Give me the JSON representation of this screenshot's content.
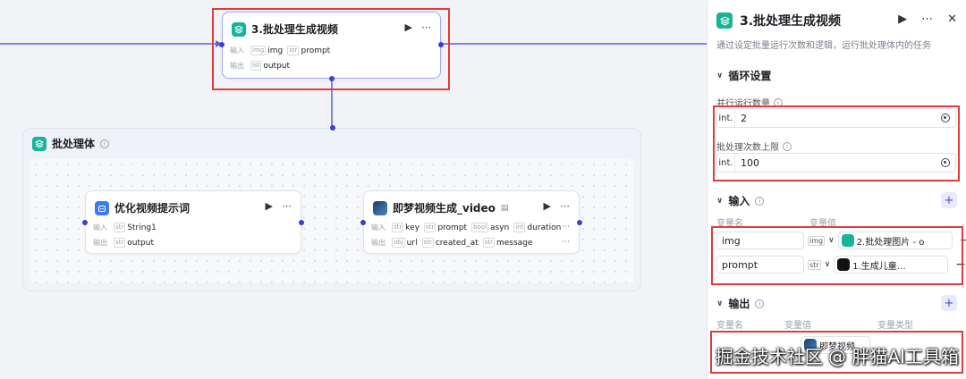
{
  "batch_node": {
    "title": "3.批处理生成视频",
    "input_label": "输入",
    "output_label": "输出",
    "inputs": [
      {
        "type": "img",
        "name": "img"
      },
      {
        "type": "str",
        "name": "prompt"
      }
    ],
    "outputs": [
      {
        "type": "lst",
        "name": "output"
      }
    ]
  },
  "group": {
    "title": "批处理体"
  },
  "optimize_node": {
    "title": "优化视频提示词",
    "input_label": "输入",
    "output_label": "输出",
    "inputs": [
      {
        "type": "str",
        "name": "String1"
      }
    ],
    "outputs": [
      {
        "type": "str",
        "name": "output"
      }
    ]
  },
  "video_node": {
    "title": "即梦视频生成_video",
    "input_label": "输入",
    "output_label": "输出",
    "inputs": [
      {
        "type": "str",
        "name": "key"
      },
      {
        "type": "str",
        "name": "prompt"
      },
      {
        "type": "bool",
        "name": "asyn"
      },
      {
        "type": "int",
        "name": "duration"
      }
    ],
    "outputs": [
      {
        "type": "obj",
        "name": "url"
      },
      {
        "type": "str",
        "name": "created_at"
      },
      {
        "type": "str",
        "name": "message"
      }
    ]
  },
  "panel": {
    "title": "3.批处理生成视频",
    "description": "通过设定批量运行次数和逻辑，运行批处理体内的任务",
    "loop_section": "循环设置",
    "parallel_label": "并行运行数量",
    "parallel_prefix": "int.",
    "parallel_value": "2",
    "max_label": "批处理次数上限",
    "max_prefix": "int.",
    "max_value": "100",
    "input_section": "输入",
    "col_var_name": "变量名",
    "col_var_value": "变量值",
    "input_rows": [
      {
        "name": "img",
        "type": "img",
        "source": "2.批处理图片 - o"
      },
      {
        "name": "prompt",
        "type": "str",
        "source": "1.生成儿童…"
      }
    ],
    "output_section": "输出",
    "col_out_name": "变量名",
    "col_out_value": "变量值",
    "col_out_type": "变量类型",
    "output_row_source": "即梦视频"
  },
  "watermark": "掘金技术社区 @ 胖猫AI工具箱"
}
